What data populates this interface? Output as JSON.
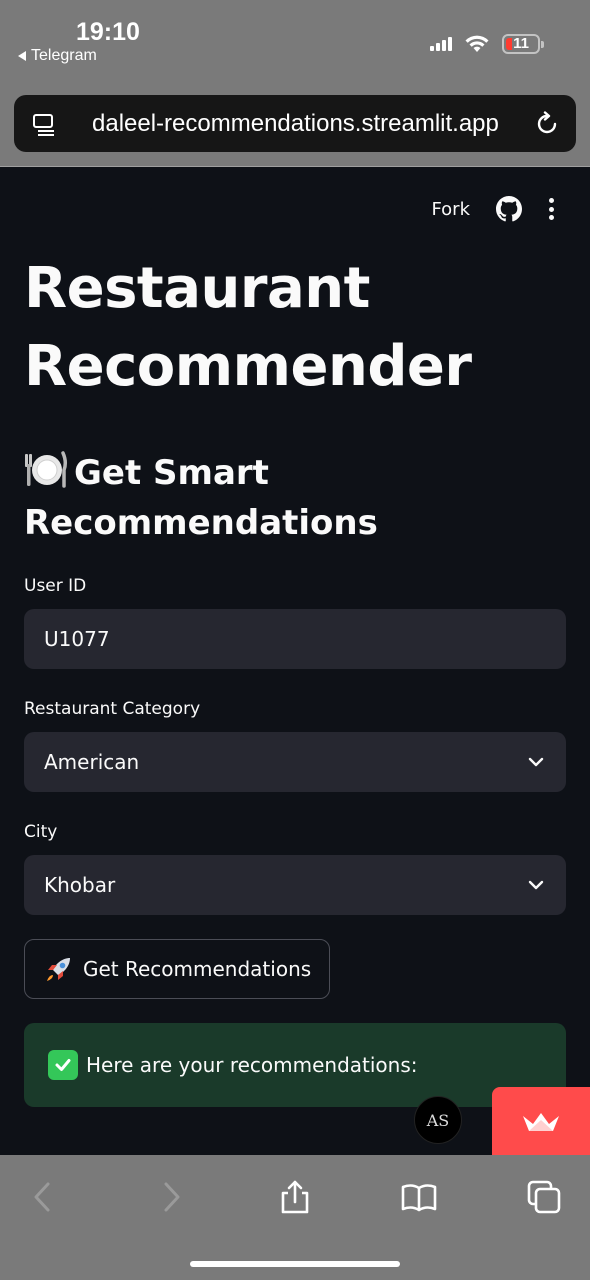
{
  "status_bar": {
    "time": "19:10",
    "back_app": "Telegram",
    "battery": "11"
  },
  "browser": {
    "url": "daleel-recommendations.streamlit.app"
  },
  "toolbar": {
    "fork_label": "Fork"
  },
  "app": {
    "title": "Restaurant Recommender",
    "subtitle": "Get Smart Recommendations",
    "fields": {
      "user_id": {
        "label": "User ID",
        "value": "U1077"
      },
      "category": {
        "label": "Restaurant Category",
        "value": "American"
      },
      "city": {
        "label": "City",
        "value": "Khobar"
      }
    },
    "button_label": "Get Recommendations",
    "success_message": "Here are your recommendations:"
  },
  "floating": {
    "avatar_initials": "AS"
  },
  "colors": {
    "background": "#0e1117",
    "input_bg": "#262730",
    "success_bg": "#1a3a2a",
    "accent": "#ff4b4b"
  },
  "icons": [
    "search-page-icon",
    "reload-icon",
    "github-icon",
    "kebab-menu-icon",
    "plate-icon",
    "chevron-down-icon",
    "rocket-icon",
    "check-icon",
    "crown-icon",
    "back-icon",
    "forward-icon",
    "share-icon",
    "bookmarks-icon",
    "tabs-icon"
  ]
}
